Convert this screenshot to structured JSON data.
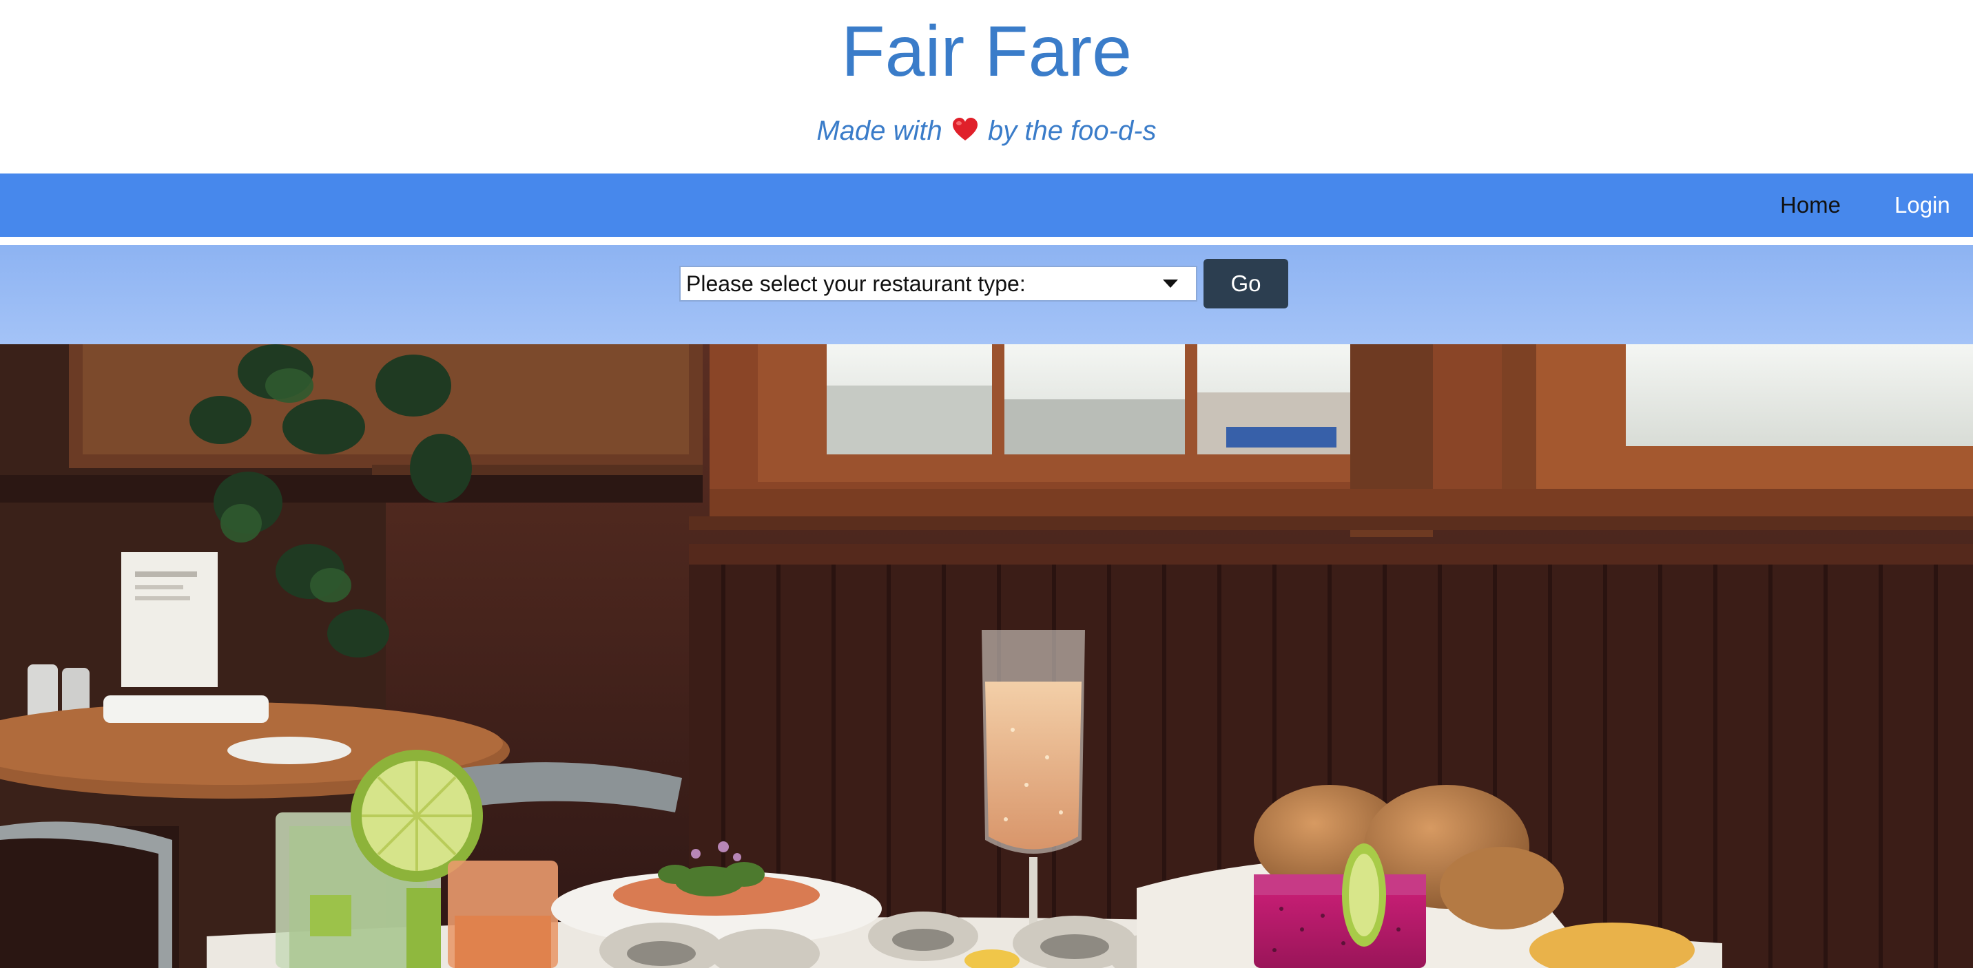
{
  "header": {
    "title": "Fair Fare",
    "tagline_prefix": "Made with",
    "tagline_suffix": "by the foo-d-s",
    "heart_icon": "red-heart-emoji"
  },
  "nav": {
    "home_label": "Home",
    "login_label": "Login"
  },
  "search": {
    "select_selected": "Please select your restaurant type:",
    "go_label": "Go"
  },
  "colors": {
    "title": "#3a7cc9",
    "navbar": "#4788ec",
    "search_bar": "#a0c0f5",
    "go_button": "#2c3e50"
  }
}
